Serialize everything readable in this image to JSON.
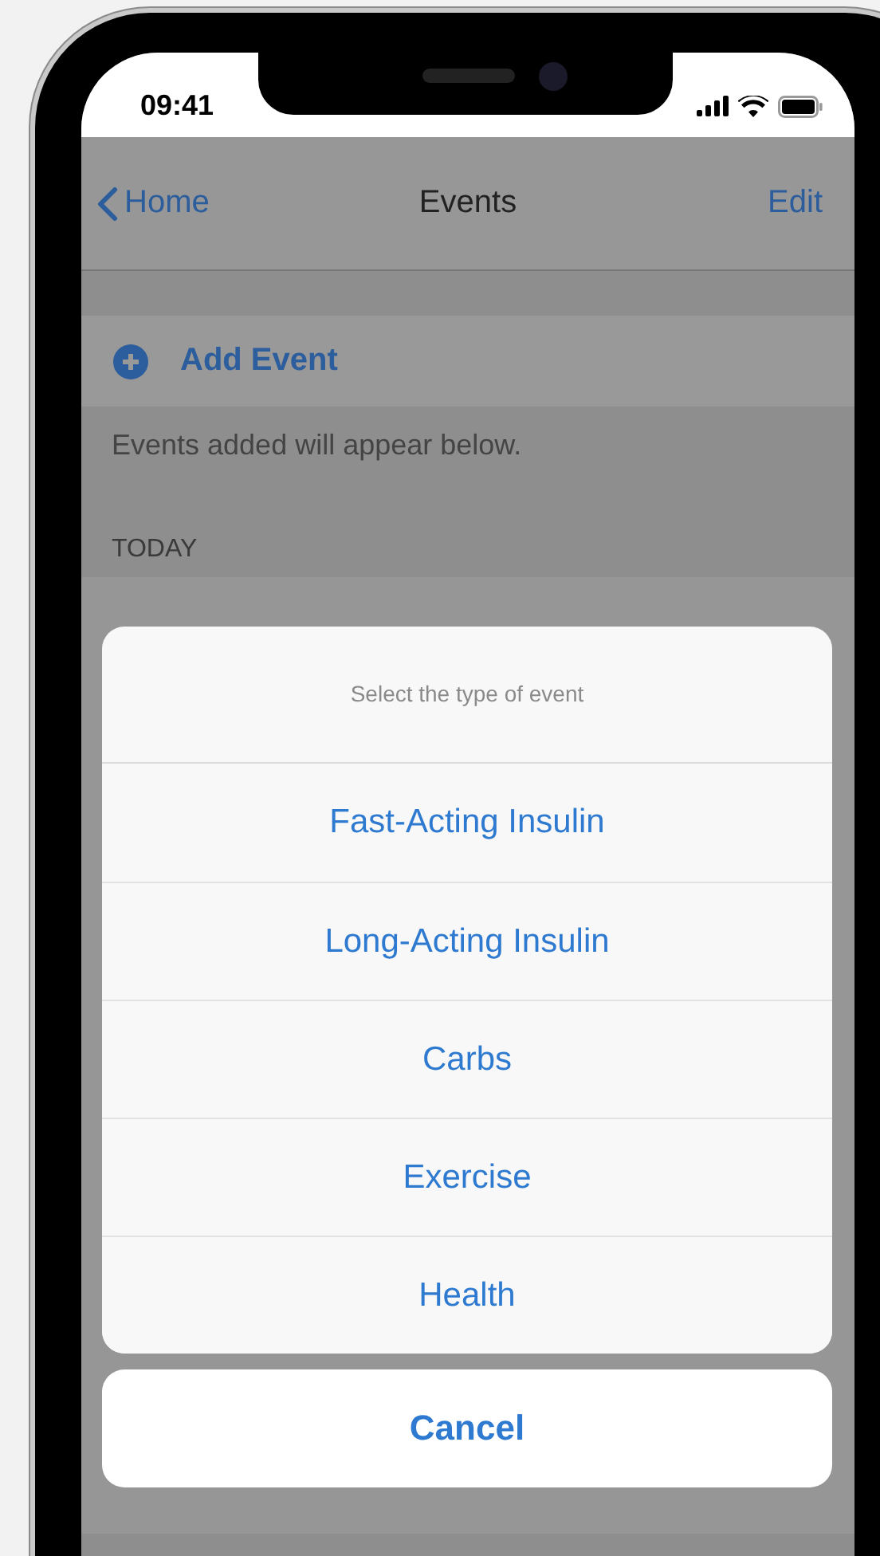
{
  "status_bar": {
    "time": "09:41"
  },
  "nav_bar": {
    "back": "Home",
    "title": "Events",
    "action": "Edit"
  },
  "add_event": {
    "label": "Add Event"
  },
  "footer_note": "Events added will appear below.",
  "section_header": "TODAY",
  "action_sheet": {
    "title": "Select the type of event",
    "options": [
      "Fast-Acting Insulin",
      "Long-Acting Insulin",
      "Carbs",
      "Exercise",
      "Health"
    ],
    "cancel": "Cancel"
  }
}
